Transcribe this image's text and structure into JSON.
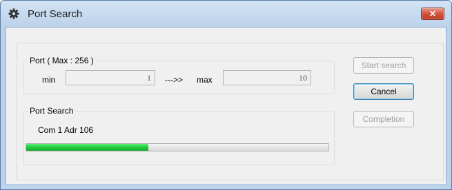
{
  "window": {
    "title": "Port Search",
    "close_glyph": "✕"
  },
  "port_group": {
    "label": "Port ( Max : 256 )",
    "min_label": "min",
    "min_value": "1",
    "arrow_label": "--->> ",
    "max_label": "max",
    "max_value": "10"
  },
  "search_group": {
    "label": "Port Search",
    "status_text": "Com 1 Adr 106",
    "progress_fraction": 0.405,
    "progress_color": "#22c93e"
  },
  "buttons": {
    "start_label": "Start search",
    "cancel_label": "Cancel",
    "completion_label": "Completion"
  },
  "icons": {
    "title_icon": "gear-icon",
    "close_icon": "close-icon"
  }
}
